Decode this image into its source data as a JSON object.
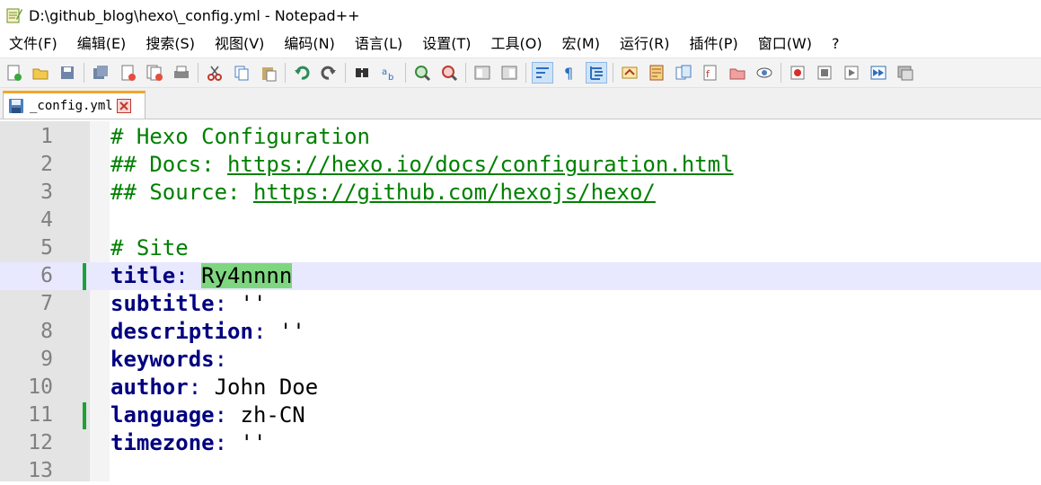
{
  "window": {
    "title": "D:\\github_blog\\hexo\\_config.yml - Notepad++"
  },
  "menu": [
    "文件(F)",
    "编辑(E)",
    "搜索(S)",
    "视图(V)",
    "编码(N)",
    "语言(L)",
    "设置(T)",
    "工具(O)",
    "宏(M)",
    "运行(R)",
    "插件(P)",
    "窗口(W)",
    "?"
  ],
  "toolbar_icons": [
    "new-file-icon",
    "open-file-icon",
    "save-icon",
    "save-all-icon",
    "close-icon",
    "close-all-icon",
    "print-icon",
    "cut-icon",
    "copy-icon",
    "paste-icon",
    "undo-icon",
    "redo-icon",
    "find-icon",
    "replace-icon",
    "zoom-in-icon",
    "zoom-out-icon",
    "sync-vertical-icon",
    "sync-horizontal-icon",
    "word-wrap-icon",
    "show-all-chars-icon",
    "indent-guide-icon",
    "user-language-icon",
    "doc-map-icon",
    "doc-list-icon",
    "function-list-icon",
    "folder-workspace-icon",
    "monitor-icon",
    "record-macro-icon",
    "stop-macro-icon",
    "play-macro-icon",
    "run-macro-multiple-icon",
    "save-macro-icon"
  ],
  "tab": {
    "label": "_config.yml"
  },
  "editor": {
    "current_line": 6,
    "highlight_color": "#7fd680",
    "lines": [
      {
        "n": "1",
        "comment": "# Hexo Configuration"
      },
      {
        "n": "2",
        "comment": "## Docs: ",
        "url": "https://hexo.io/docs/configuration.html"
      },
      {
        "n": "3",
        "comment": "## Source: ",
        "url": "https://github.com/hexojs/hexo/"
      },
      {
        "n": "4"
      },
      {
        "n": "5",
        "comment": "# Site"
      },
      {
        "n": "6",
        "key": "title",
        "value": "Ry4nnnn",
        "changed": true,
        "highlight": true
      },
      {
        "n": "7",
        "key": "subtitle",
        "value": "''"
      },
      {
        "n": "8",
        "key": "description",
        "value": "''"
      },
      {
        "n": "9",
        "key": "keywords",
        "value": ""
      },
      {
        "n": "10",
        "key": "author",
        "value": "John Doe"
      },
      {
        "n": "11",
        "key": "language",
        "value": "zh-CN",
        "changed": true
      },
      {
        "n": "12",
        "key": "timezone",
        "value": "''"
      },
      {
        "n": "13"
      }
    ]
  }
}
